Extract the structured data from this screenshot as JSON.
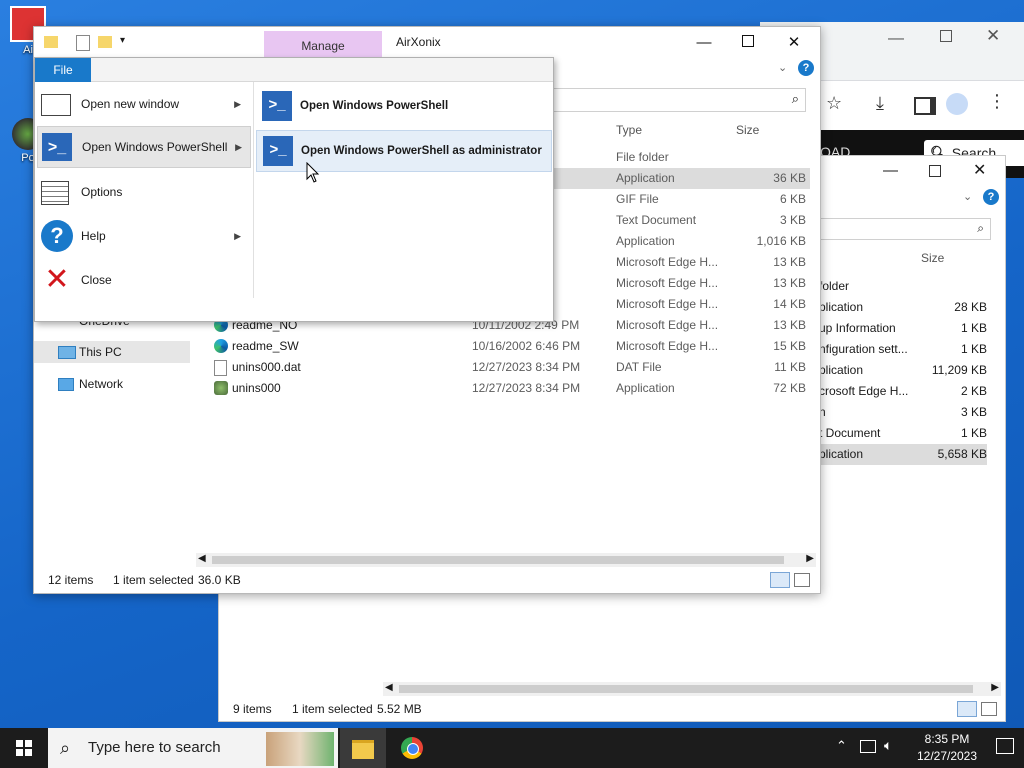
{
  "desktop": {
    "icons": [
      {
        "label": "Ai"
      },
      {
        "label": "Po"
      }
    ]
  },
  "browser": {
    "search_label": "Search",
    "download_label": "OAD"
  },
  "explorer2": {
    "header_size": "Size",
    "rows": [
      {
        "type": "folder",
        "size": ""
      },
      {
        "type": "plication",
        "size": "28 KB"
      },
      {
        "type": "up Information",
        "size": "1 KB"
      },
      {
        "type": "nfiguration sett...",
        "size": "1 KB"
      },
      {
        "type": "plication",
        "size": "11,209 KB"
      },
      {
        "type": "crosoft Edge H...",
        "size": "2 KB"
      },
      {
        "type": "n",
        "size": "3 KB"
      },
      {
        "type": "t Document",
        "size": "1 KB"
      },
      {
        "type": "plication",
        "size": "5,658 KB"
      }
    ],
    "status_items": "9 items",
    "status_selected": "1 item selected",
    "status_size": "5.52 MB"
  },
  "explorer": {
    "ribbon_tab_manage": "Manage",
    "window_title": "AirXonix",
    "column_type": "Type",
    "column_size": "Size",
    "search_glyph": "⌕",
    "files": [
      {
        "name": "",
        "date": "PM",
        "type": "File folder",
        "size": "",
        "selected": false
      },
      {
        "name": "",
        "date": "AM",
        "type": "Application",
        "size": "36 KB",
        "selected": true
      },
      {
        "name": "",
        "date": "AM",
        "type": "GIF File",
        "size": "6 KB",
        "selected": false
      },
      {
        "name": "",
        "date": "AM",
        "type": "Text Document",
        "size": "3 KB",
        "selected": false
      },
      {
        "name": "",
        "date": "PM",
        "type": "Application",
        "size": "1,016 KB",
        "selected": false
      },
      {
        "name": "",
        "date": "PM",
        "type": "Microsoft Edge H...",
        "size": "13 KB",
        "selected": false
      },
      {
        "name": "",
        "date": "PM",
        "type": "Microsoft Edge H...",
        "size": "13 KB",
        "selected": false
      },
      {
        "name": "",
        "date": "PM",
        "type": "Microsoft Edge H...",
        "size": "14 KB",
        "selected": false
      },
      {
        "name": "readme_NO",
        "date": "10/11/2002 2:49 PM",
        "type": "Microsoft Edge H...",
        "size": "13 KB",
        "selected": false
      },
      {
        "name": "readme_SW",
        "date": "10/16/2002 6:46 PM",
        "type": "Microsoft Edge H...",
        "size": "15 KB",
        "selected": false
      },
      {
        "name": "unins000.dat",
        "date": "12/27/2023 8:34 PM",
        "type": "DAT File",
        "size": "11 KB",
        "selected": false
      },
      {
        "name": "unins000",
        "date": "12/27/2023 8:34 PM",
        "type": "Application",
        "size": "72 KB",
        "selected": false
      }
    ],
    "nav": {
      "onedrive": "OneDrive",
      "thispc": "This PC",
      "network": "Network"
    },
    "status_items": "12 items",
    "status_selected": "1 item selected",
    "status_size": "36.0 KB"
  },
  "filemenu": {
    "tab_label": "File",
    "items": [
      {
        "label": "Open new window"
      },
      {
        "label": "Open Windows PowerShell"
      },
      {
        "label": "Options"
      },
      {
        "label": "Help"
      },
      {
        "label": "Close"
      }
    ],
    "submenu": [
      {
        "label": "Open Windows PowerShell"
      },
      {
        "label": "Open Windows PowerShell as administrator"
      }
    ]
  },
  "taskbar": {
    "search_placeholder": "Type here to search",
    "time": "8:35 PM",
    "date": "12/27/2023"
  },
  "colors": {
    "accent": "#1979ca",
    "manage_tab": "#e8c6f2",
    "taskbar": "#1c1c1c"
  }
}
